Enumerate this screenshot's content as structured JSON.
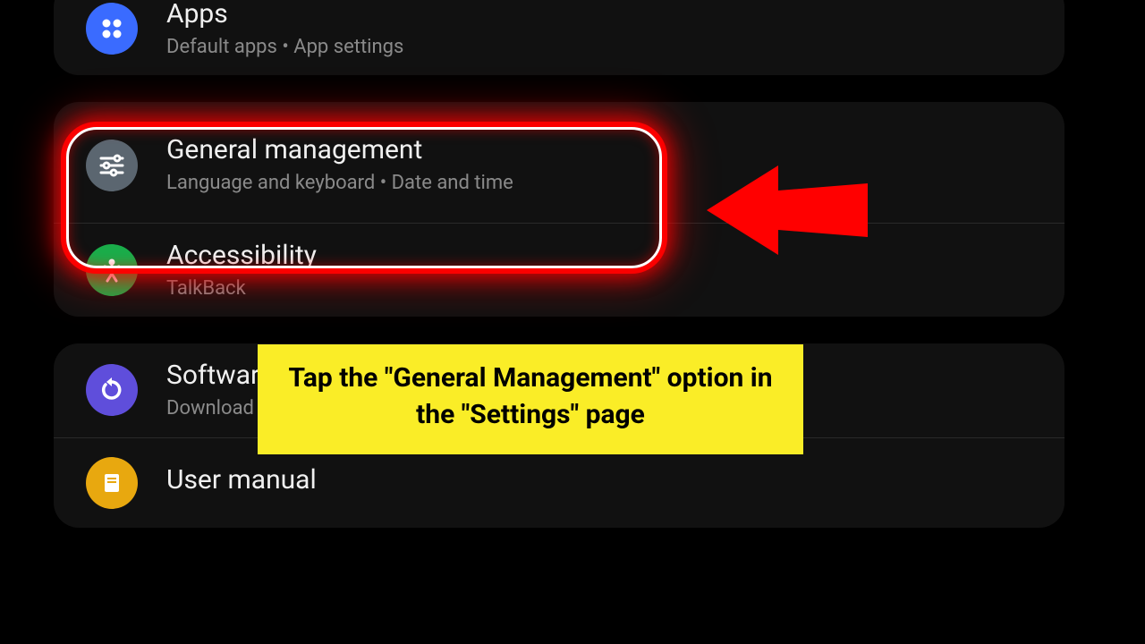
{
  "settings": {
    "apps": {
      "title": "Apps",
      "subtitle": "Default apps  •  App settings"
    },
    "general": {
      "title": "General management",
      "subtitle": "Language and keyboard  •  Date and time"
    },
    "accessibility": {
      "title": "Accessibility",
      "subtitle": "TalkBack"
    },
    "software": {
      "title": "Software update",
      "subtitle": "Download and install"
    },
    "manual": {
      "title": "User manual",
      "subtitle": ""
    }
  },
  "annotation": {
    "callout": "Tap the \"General Management\" option in the \"Settings\" page"
  }
}
